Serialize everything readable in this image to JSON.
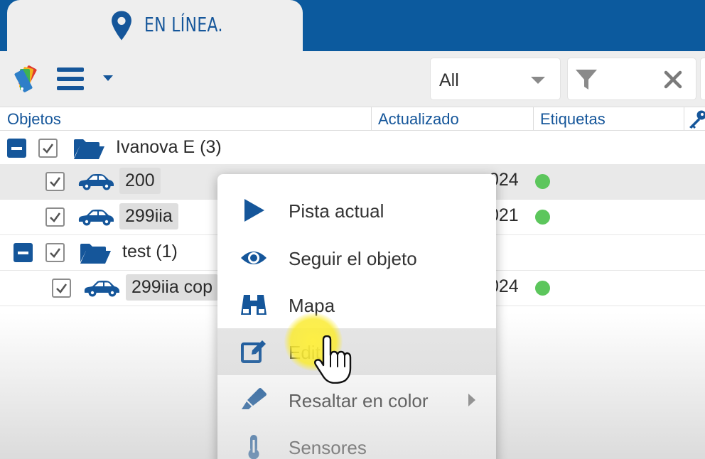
{
  "tab": {
    "label": "EN LÍNEA.",
    "icon": "map-pin-icon"
  },
  "toolbar": {
    "tags_icon": "color-tags-icon",
    "menu_icon": "hamburger-menu-icon",
    "menu_caret_icon": "caret-down-icon",
    "select_value": "All",
    "filter_icon": "funnel-icon",
    "clear_icon": "close-icon"
  },
  "columns": {
    "objects": "Objetos",
    "updated": "Actualizado",
    "tags": "Etiquetas",
    "key_icon": "key-icon"
  },
  "tree": [
    {
      "type": "group",
      "label": "Ivanova E (3)"
    },
    {
      "type": "object",
      "label": "200",
      "updated": "024",
      "status_color": "#5cc65c"
    },
    {
      "type": "object",
      "label": "299iia",
      "updated": "021",
      "status_color": "#5cc65c"
    },
    {
      "type": "group",
      "label": "test (1)"
    },
    {
      "type": "object",
      "label": "299iia cop",
      "updated": "024",
      "status_color": "#5cc65c"
    }
  ],
  "context_menu": {
    "items": [
      {
        "label": "Pista actual",
        "icon": "play-icon"
      },
      {
        "label": "Seguir el objeto",
        "icon": "eye-icon"
      },
      {
        "label": "Mapa",
        "icon": "binoculars-icon"
      },
      {
        "label": "Edit",
        "icon": "edit-icon",
        "active": true
      },
      {
        "label": "Resaltar en color",
        "icon": "marker-icon",
        "has_submenu": true
      },
      {
        "label": "Sensores",
        "icon": "thermometer-icon"
      }
    ]
  },
  "colors": {
    "brand_blue": "#0c5a9e",
    "status_green": "#5cc65c"
  }
}
